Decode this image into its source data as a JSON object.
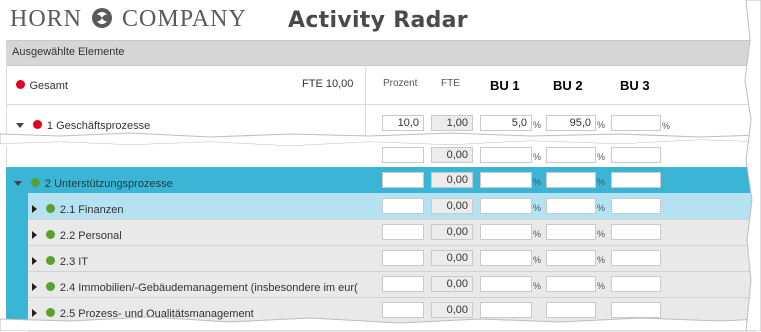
{
  "header": {
    "logo_left": "HORN",
    "logo_right": "COMPANY",
    "app_title": "Activity Radar"
  },
  "section": {
    "title": "Ausgewählte Elemente"
  },
  "columns": {
    "prozent": "Prozent",
    "fte": "FTE",
    "bu1": "BU 1",
    "bu2": "BU 2",
    "bu3": "BU 3"
  },
  "total": {
    "label": "Gesamt",
    "fte": "FTE 10,00"
  },
  "percent_sign": "%",
  "colors": {
    "accent": "#3bb5d6",
    "selected": "#b5e2f0",
    "red": "#e2001a",
    "green": "#5aa02c"
  },
  "rows": [
    {
      "label": "1 Geschäftsprozesse",
      "prozent": "10,0",
      "fte": "1,00",
      "bu1": "5,0",
      "bu2": "95,0",
      "bu3": ""
    },
    {
      "label": "",
      "prozent": "",
      "fte": "0,00",
      "bu1": "",
      "bu2": "",
      "bu3": ""
    },
    {
      "label": "2 Unterstützungsprozesse",
      "prozent": "",
      "fte": "0,00",
      "bu1": "",
      "bu2": "",
      "bu3": ""
    },
    {
      "label": "2.1 Finanzen",
      "prozent": "",
      "fte": "0,00",
      "bu1": "",
      "bu2": "",
      "bu3": ""
    },
    {
      "label": "2.2 Personal",
      "prozent": "",
      "fte": "0,00",
      "bu1": "",
      "bu2": "",
      "bu3": ""
    },
    {
      "label": "2.3 IT",
      "prozent": "",
      "fte": "0,00",
      "bu1": "",
      "bu2": "",
      "bu3": ""
    },
    {
      "label": "2.4 Immobilien/-Gebäudemanagement (insbesondere im eur(",
      "prozent": "",
      "fte": "0,00",
      "bu1": "",
      "bu2": "",
      "bu3": ""
    },
    {
      "label": "2.5 Prozess- und Qualitätsmanagement",
      "prozent": "",
      "fte": "0,00",
      "bu1": "",
      "bu2": "",
      "bu3": ""
    }
  ]
}
